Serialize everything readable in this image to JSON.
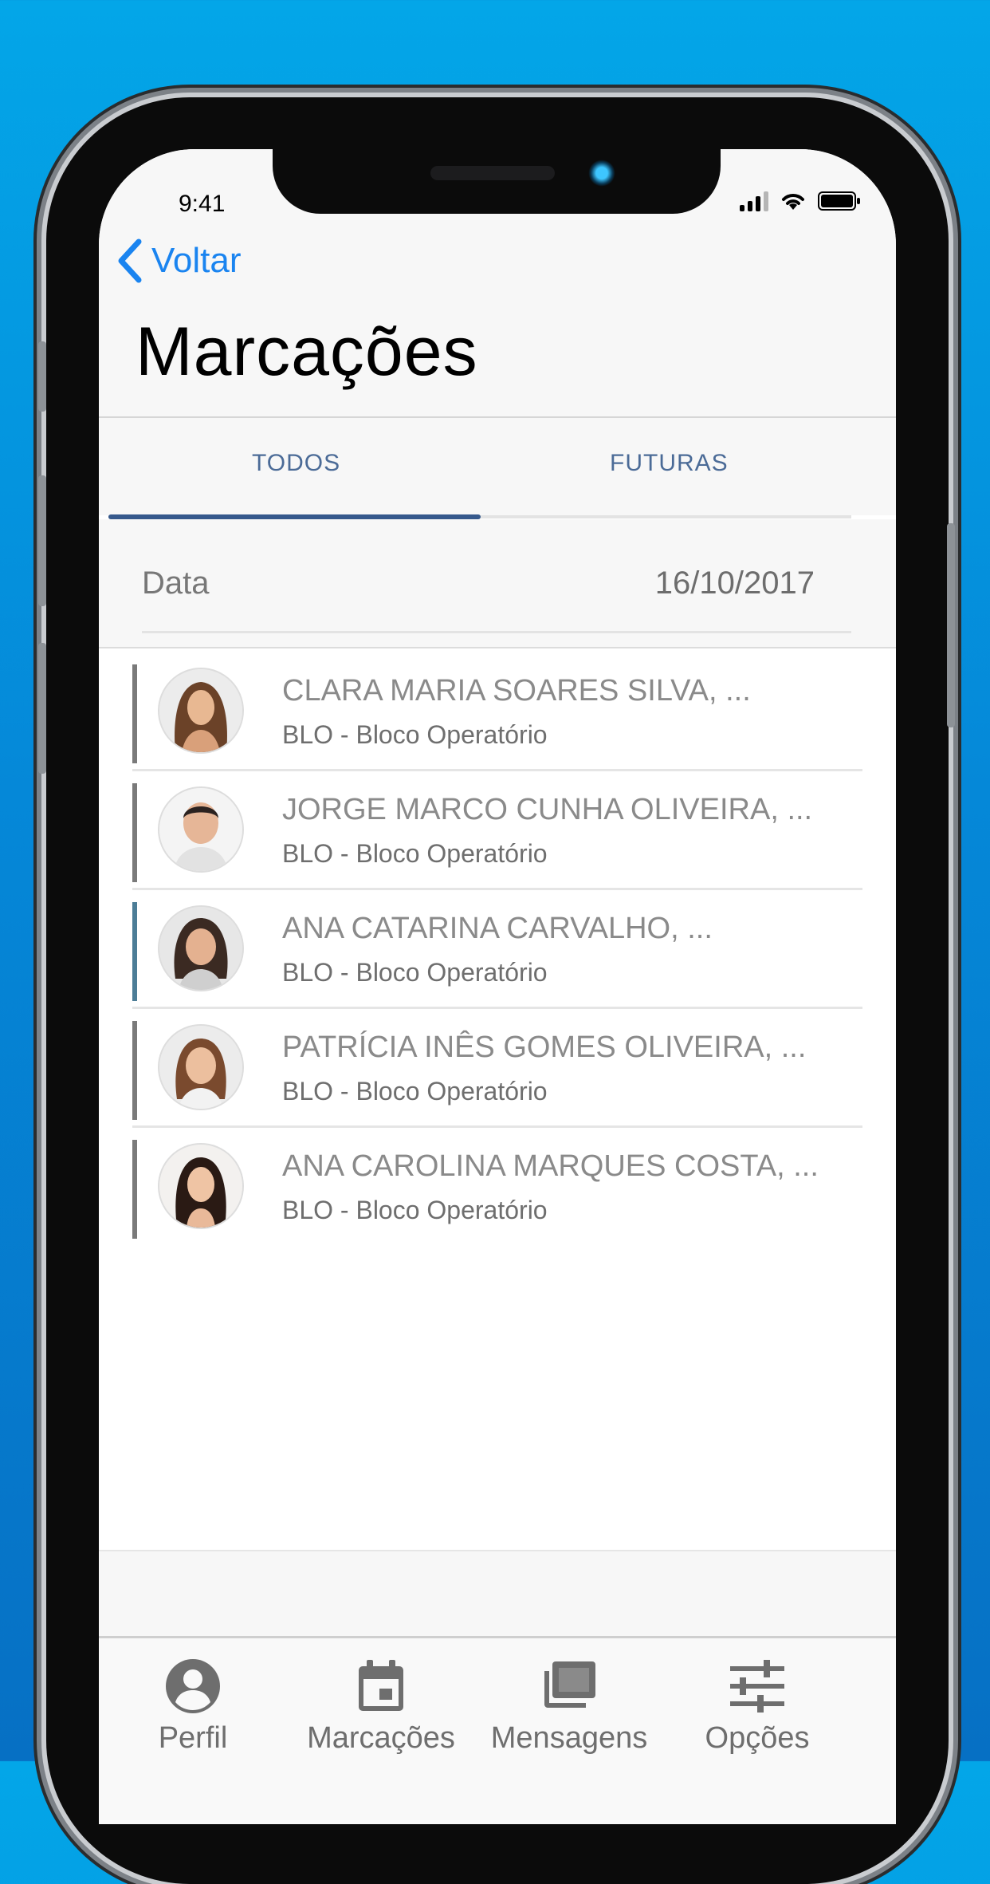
{
  "status_bar": {
    "time": "9:41"
  },
  "nav": {
    "back_label": "Voltar",
    "title": "Marcações"
  },
  "tabs": [
    {
      "label": "TODOS",
      "active": true
    },
    {
      "label": "FUTURAS",
      "active": false
    }
  ],
  "date_row": {
    "label": "Data",
    "value": "16/10/2017"
  },
  "appointments": [
    {
      "name": "CLARA MARIA SOARES SILVA, ...",
      "dept": "BLO - Bloco Operatório",
      "bar_color": "#7a7a7a"
    },
    {
      "name": "JORGE MARCO CUNHA OLIVEIRA, ...",
      "dept": "BLO - Bloco Operatório",
      "bar_color": "#7a7a7a"
    },
    {
      "name": "ANA CATARINA CARVALHO, ...",
      "dept": "BLO - Bloco Operatório",
      "bar_color": "#4c7d97"
    },
    {
      "name": "PATRÍCIA INÊS GOMES OLIVEIRA, ...",
      "dept": "BLO - Bloco Operatório",
      "bar_color": "#7a7a7a"
    },
    {
      "name": "ANA CAROLINA MARQUES COSTA, ...",
      "dept": "BLO - Bloco Operatório",
      "bar_color": "#7a7a7a"
    }
  ],
  "tab_bar": [
    {
      "label": "Perfil",
      "icon": "person-icon"
    },
    {
      "label": "Marcações",
      "icon": "calendar-icon"
    },
    {
      "label": "Mensagens",
      "icon": "messages-icon"
    },
    {
      "label": "Opções",
      "icon": "sliders-icon"
    }
  ],
  "colors": {
    "accent": "#1a84f0",
    "tab_text": "#4b6b97",
    "tab_indicator": "#36598c"
  }
}
